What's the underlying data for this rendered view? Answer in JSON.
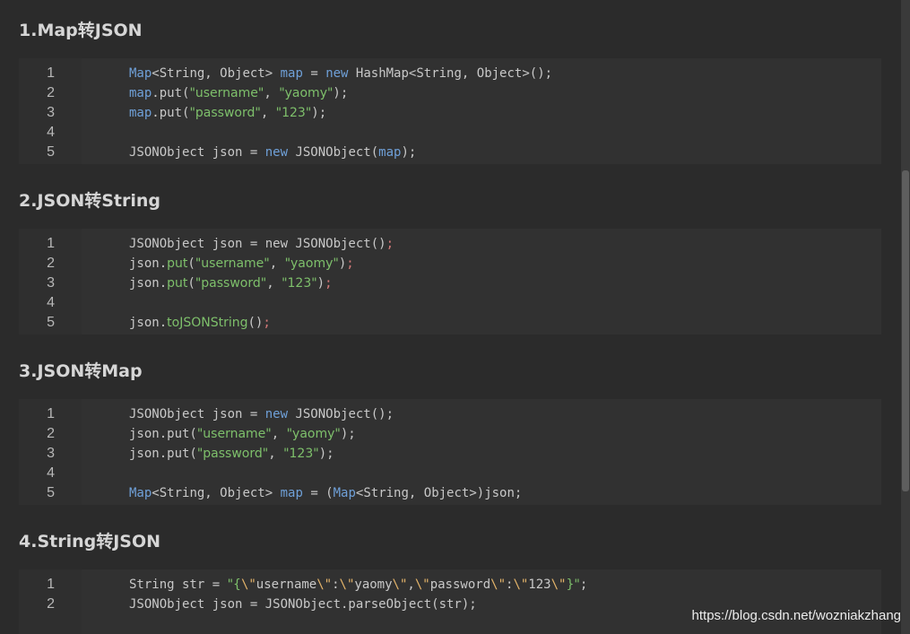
{
  "sections": [
    {
      "title": "1.Map转JSON",
      "lines": [
        {
          "n": "1",
          "tokens": [
            [
              "kw",
              "Map"
            ],
            [
              "p",
              "<String, Object> "
            ],
            [
              "kw",
              "map"
            ],
            [
              "p",
              " = "
            ],
            [
              "kw",
              "new"
            ],
            [
              "p",
              " HashMap<String, Object>();"
            ]
          ]
        },
        {
          "n": "2",
          "tokens": [
            [
              "kw",
              "map"
            ],
            [
              "p",
              ".put("
            ],
            [
              "str",
              "\"username\""
            ],
            [
              "p",
              ", "
            ],
            [
              "str",
              "\"yaomy\""
            ],
            [
              "p",
              ");"
            ]
          ]
        },
        {
          "n": "3",
          "tokens": [
            [
              "kw",
              "map"
            ],
            [
              "p",
              ".put("
            ],
            [
              "str",
              "\"password\""
            ],
            [
              "p",
              ", "
            ],
            [
              "str",
              "\"123\""
            ],
            [
              "p",
              ");"
            ]
          ]
        },
        {
          "n": "4",
          "tokens": []
        },
        {
          "n": "5",
          "tokens": [
            [
              "p",
              "JSONObject json = "
            ],
            [
              "kw",
              "new"
            ],
            [
              "p",
              " JSONObject("
            ],
            [
              "kw",
              "map"
            ],
            [
              "p",
              ");"
            ]
          ]
        }
      ]
    },
    {
      "title": "2.JSON转String",
      "lines": [
        {
          "n": "1",
          "tokens": [
            [
              "p",
              "JSONObject json = new JSONObject()"
            ],
            [
              "semi",
              ";"
            ]
          ]
        },
        {
          "n": "2",
          "tokens": [
            [
              "p",
              "json."
            ],
            [
              "str",
              "put"
            ],
            [
              "p",
              "("
            ],
            [
              "str",
              "\"username\""
            ],
            [
              "p",
              ", "
            ],
            [
              "str",
              "\"yaomy\""
            ],
            [
              "p",
              ")"
            ],
            [
              "semi",
              ";"
            ]
          ]
        },
        {
          "n": "3",
          "tokens": [
            [
              "p",
              "json."
            ],
            [
              "str",
              "put"
            ],
            [
              "p",
              "("
            ],
            [
              "str",
              "\"password\""
            ],
            [
              "p",
              ", "
            ],
            [
              "str",
              "\"123\""
            ],
            [
              "p",
              ")"
            ],
            [
              "semi",
              ";"
            ]
          ]
        },
        {
          "n": "4",
          "tokens": []
        },
        {
          "n": "5",
          "tokens": [
            [
              "p",
              "json."
            ],
            [
              "str",
              "toJSONString"
            ],
            [
              "p",
              "()"
            ],
            [
              "semi",
              ";"
            ]
          ]
        }
      ]
    },
    {
      "title": "3.JSON转Map",
      "lines": [
        {
          "n": "1",
          "tokens": [
            [
              "p",
              "JSONObject json = "
            ],
            [
              "kw",
              "new"
            ],
            [
              "p",
              " JSONObject();"
            ]
          ]
        },
        {
          "n": "2",
          "tokens": [
            [
              "p",
              "json.put("
            ],
            [
              "str",
              "\"username\""
            ],
            [
              "p",
              ", "
            ],
            [
              "str",
              "\"yaomy\""
            ],
            [
              "p",
              ");"
            ]
          ]
        },
        {
          "n": "3",
          "tokens": [
            [
              "p",
              "json.put("
            ],
            [
              "str",
              "\"password\""
            ],
            [
              "p",
              ", "
            ],
            [
              "str",
              "\"123\""
            ],
            [
              "p",
              ");"
            ]
          ]
        },
        {
          "n": "4",
          "tokens": []
        },
        {
          "n": "5",
          "tokens": [
            [
              "kw",
              "Map"
            ],
            [
              "p",
              "<String, Object> "
            ],
            [
              "kw",
              "map"
            ],
            [
              "p",
              " = ("
            ],
            [
              "kw",
              "Map"
            ],
            [
              "p",
              "<String, Object>)json;"
            ]
          ]
        }
      ]
    },
    {
      "title": "4.String转JSON",
      "lines": [
        {
          "n": "1",
          "tokens": [
            [
              "p",
              "String str = "
            ],
            [
              "str",
              "\"{"
            ],
            [
              "esc",
              "\\\""
            ],
            [
              "p",
              "username"
            ],
            [
              "esc",
              "\\\""
            ],
            [
              "p",
              ":"
            ],
            [
              "esc",
              "\\\""
            ],
            [
              "p",
              "yaomy"
            ],
            [
              "esc",
              "\\\""
            ],
            [
              "p",
              ","
            ],
            [
              "esc",
              "\\\""
            ],
            [
              "p",
              "password"
            ],
            [
              "esc",
              "\\\""
            ],
            [
              "p",
              ":"
            ],
            [
              "esc",
              "\\\""
            ],
            [
              "p",
              "123"
            ],
            [
              "esc",
              "\\\""
            ],
            [
              "str",
              "}\""
            ],
            [
              "p",
              ";"
            ]
          ]
        },
        {
          "n": "2",
          "tokens": [
            [
              "p",
              "JSONObject json = JSONObject.parseObject(str);"
            ]
          ]
        }
      ]
    }
  ],
  "watermark": "https://blog.csdn.net/wozniakzhang",
  "colors": {
    "background": "#2b2b2b",
    "keyword": "#6fa0d8",
    "string": "#7ec06b",
    "escape": "#e4b46a",
    "semicolon": "#d57a7a"
  }
}
